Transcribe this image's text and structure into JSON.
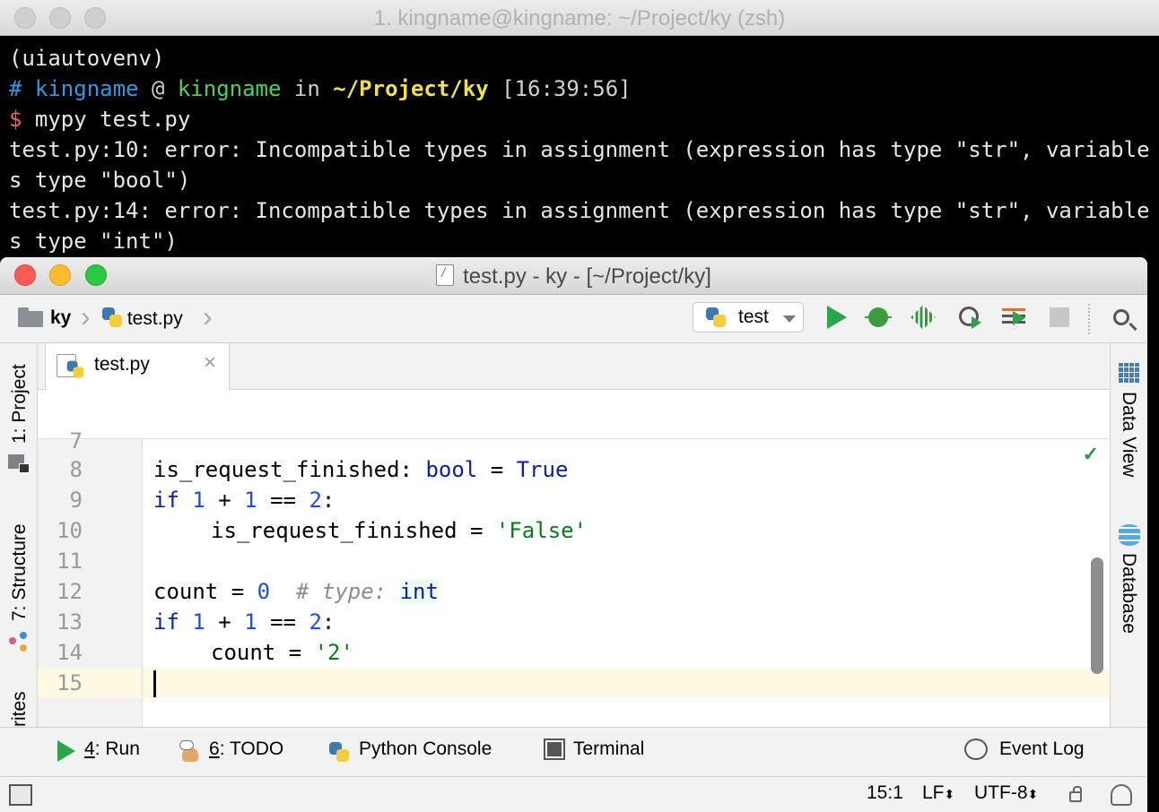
{
  "terminal": {
    "title": "1. kingname@kingname: ~/Project/ky (zsh)",
    "line1": "(uiautovenv)",
    "prompt": {
      "hash": "#",
      "user": "kingname",
      "at": "@",
      "host": "kingname",
      "in": "in",
      "path": "~/Project/ky",
      "time": "[16:39:56]"
    },
    "command": {
      "dollar": "$",
      "text": "mypy test.py"
    },
    "errors": [
      "test.py:10: error: Incompatible types in assignment (expression has type \"str\", variable ha",
      "s type \"bool\")",
      "test.py:14: error: Incompatible types in assignment (expression has type \"str\", variable ha",
      "s type \"int\")"
    ]
  },
  "ide": {
    "title": "test.py - ky - [~/Project/ky]",
    "breadcrumb": {
      "project": "ky",
      "file": "test.py"
    },
    "run_config": "test",
    "left_tabs": {
      "project": "1: Project",
      "structure": "7: Structure",
      "favorites": "rites"
    },
    "right_tabs": {
      "data_view": "Data View",
      "database": "Database"
    },
    "tab": {
      "label": "test.py",
      "close": "×"
    },
    "line_numbers": [
      "7",
      "8",
      "9",
      "10",
      "11",
      "12",
      "13",
      "14",
      "15"
    ],
    "code": {
      "l8": {
        "name": "is_request_finished",
        "colon": ":",
        "type": "bool",
        "eq": "=",
        "value": "True"
      },
      "l9": {
        "kw": "if",
        "a": "1",
        "plus": "+",
        "b": "1",
        "op": "==",
        "c": "2",
        "colon": ":"
      },
      "l10": {
        "name": "is_request_finished",
        "eq": "=",
        "str": "'False'"
      },
      "l12": {
        "name": "count",
        "eq": "=",
        "num": "0",
        "comment": "# type:",
        "type": "int"
      },
      "l13": {
        "kw": "if",
        "a": "1",
        "plus": "+",
        "b": "1",
        "op": "==",
        "c": "2",
        "colon": ":"
      },
      "l14": {
        "name": "count",
        "eq": "=",
        "str": "'2'"
      }
    },
    "bottom_tools": {
      "run_num": "4",
      "run": ": Run",
      "todo_num": "6",
      "todo": ": TODO",
      "python_console": "Python Console",
      "terminal": "Terminal",
      "event_log": "Event Log"
    },
    "status": {
      "position": "15:1",
      "line_sep": "LF",
      "encoding": "UTF-8",
      "updown": "⬍"
    }
  },
  "icons": {
    "inspection": "inspection-check-icon"
  }
}
